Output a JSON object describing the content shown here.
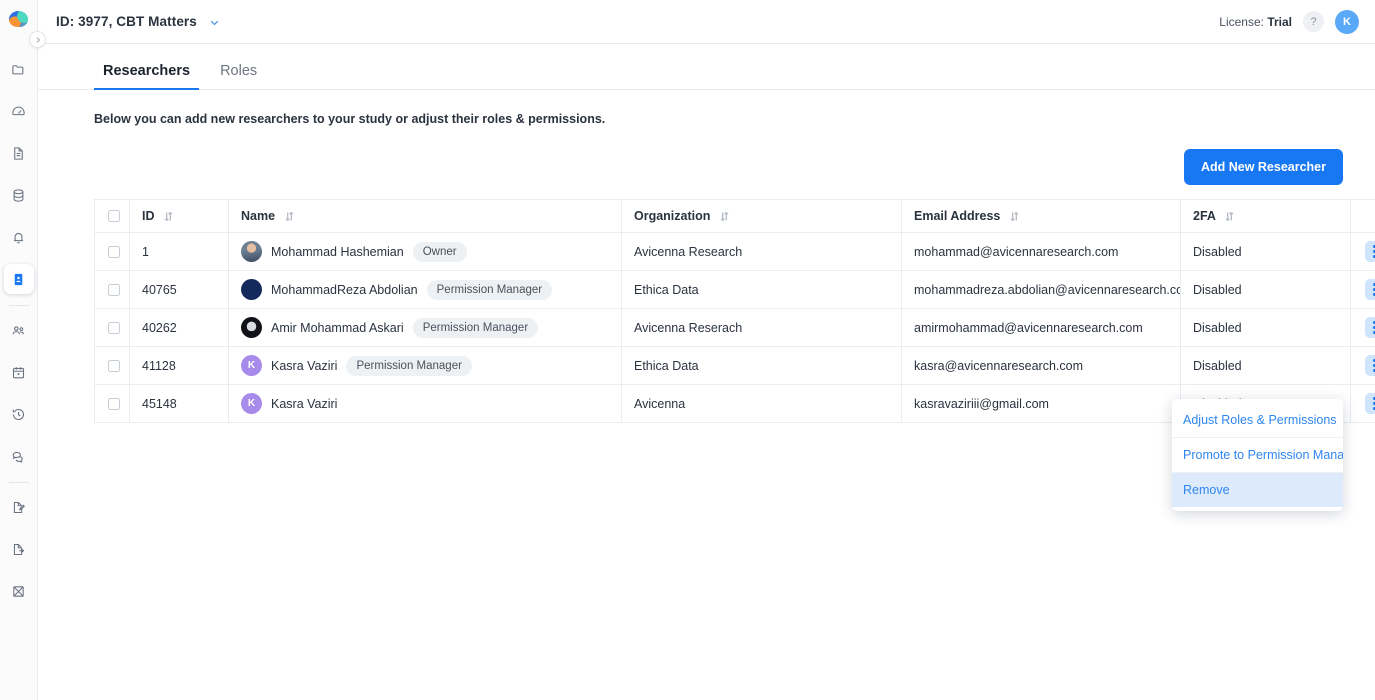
{
  "app": {
    "logo_icon": "brain-logo",
    "study_label": "ID: 3977, CBT Matters",
    "license_prefix": "License:",
    "license_value": "Trial",
    "help_label": "?",
    "user_initial": "K",
    "accent_color": "#1877f2",
    "avatar_color": "#5aa9f8"
  },
  "sidebar": {
    "collapse_icon": "chevron-right-icon",
    "items": [
      {
        "icon": "folder-icon",
        "active": false
      },
      {
        "icon": "gauge-icon",
        "active": false
      },
      {
        "icon": "document-icon",
        "active": false
      },
      {
        "icon": "database-icon",
        "active": false
      },
      {
        "icon": "bell-icon",
        "active": false
      },
      {
        "icon": "id-badge-icon",
        "active": true
      },
      {
        "icon": "divider",
        "active": false
      },
      {
        "icon": "people-icon",
        "active": false
      },
      {
        "icon": "calendar-icon",
        "active": false
      },
      {
        "icon": "history-icon",
        "active": false
      },
      {
        "icon": "chat-icon",
        "active": false
      },
      {
        "icon": "divider",
        "active": false
      },
      {
        "icon": "document-edit-icon",
        "active": false
      },
      {
        "icon": "document-export-icon",
        "active": false
      },
      {
        "icon": "chart-crossed-icon",
        "active": false
      }
    ]
  },
  "tabs": [
    {
      "label": "Researchers",
      "selected": true
    },
    {
      "label": "Roles",
      "selected": false
    }
  ],
  "main": {
    "description": "Below you can add new researchers to your study or adjust their roles & permissions.",
    "add_button": "Add New Researcher"
  },
  "table": {
    "columns": [
      {
        "key": "checkbox",
        "label": "",
        "sortable": false
      },
      {
        "key": "id",
        "label": "ID",
        "sortable": true
      },
      {
        "key": "name",
        "label": "Name",
        "sortable": true
      },
      {
        "key": "organization",
        "label": "Organization",
        "sortable": true
      },
      {
        "key": "email",
        "label": "Email Address",
        "sortable": true
      },
      {
        "key": "twofa",
        "label": "2FA",
        "sortable": true
      },
      {
        "key": "actions",
        "label": "",
        "sortable": false
      }
    ],
    "rows": [
      {
        "id": "1",
        "name": "Mohammad Hashemian",
        "badge": "Owner",
        "avatar_kind": "photo1",
        "avatar_initial": "",
        "organization": "Avicenna Research",
        "email": "mohammad@avicennaresearch.com",
        "twofa": "Disabled"
      },
      {
        "id": "40765",
        "name": "MohammadReza Abdolian",
        "badge": "Permission Manager",
        "avatar_kind": "navy",
        "avatar_initial": "",
        "organization": "Ethica Data",
        "email": "mohammadreza.abdolian@avicennaresearch.com",
        "twofa": "Disabled"
      },
      {
        "id": "40262",
        "name": "Amir Mohammad Askari",
        "badge": "Permission Manager",
        "avatar_kind": "photo2",
        "avatar_initial": "",
        "organization": "Avicenna Reserach",
        "email": "amirmohammad@avicennaresearch.com",
        "twofa": "Disabled"
      },
      {
        "id": "41128",
        "name": "Kasra Vaziri",
        "badge": "Permission Manager",
        "avatar_kind": "purple",
        "avatar_initial": "K",
        "organization": "Ethica Data",
        "email": "kasra@avicennaresearch.com",
        "twofa": "Disabled"
      },
      {
        "id": "45148",
        "name": "Kasra Vaziri",
        "badge": "",
        "avatar_kind": "purple",
        "avatar_initial": "K",
        "organization": "Avicenna",
        "email": "kasravaziriii@gmail.com",
        "twofa": "Disabled"
      }
    ]
  },
  "context_menu": {
    "open": true,
    "items": [
      {
        "label": "Adjust Roles & Permissions",
        "hovered": false
      },
      {
        "label": "Promote to Permission Manager",
        "hovered": false
      },
      {
        "label": "Remove",
        "hovered": true
      }
    ]
  }
}
